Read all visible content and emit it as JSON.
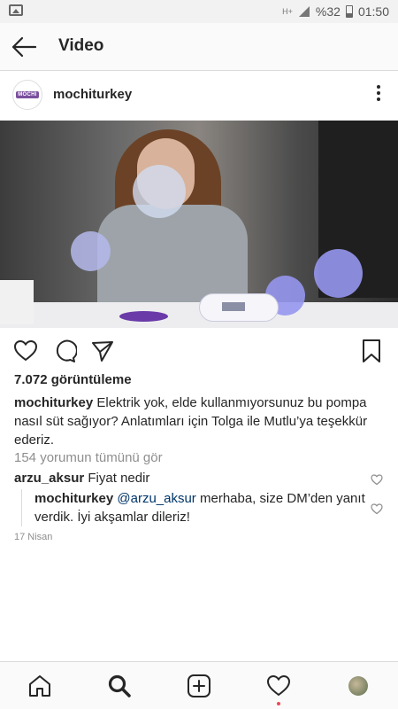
{
  "status_bar": {
    "battery": "%32",
    "time": "01:50",
    "network": "H+"
  },
  "header": {
    "title": "Video"
  },
  "post": {
    "username": "mochiturkey",
    "avatar_logo_text": "MOCHI",
    "views": "7.072 görüntüleme",
    "caption_user": "mochiturkey",
    "caption_text": "Elektrik yok, elde kullanmıyorsunuz bu pompa nasıl süt sağıyor? Anlatımları için Tolga ile Mutlu’ya teşekkür ederiz.",
    "view_all_comments": "154 yorumun tümünü gör",
    "comment": {
      "user": "arzu_aksur",
      "text": "Fiyat nedir"
    },
    "reply": {
      "user": "mochiturkey",
      "mention": "@arzu_aksur",
      "text": "merhaba, size DM’den yanıt verdik. İyi akşamlar dileriz!"
    },
    "date": "17 Nisan"
  },
  "icons": {
    "back": "arrow-left-icon",
    "more": "more-vertical-icon",
    "like": "heart-icon",
    "comment": "comment-icon",
    "share": "send-icon",
    "save": "bookmark-icon",
    "home": "home-icon",
    "search": "search-icon",
    "add": "add-post-icon",
    "activity": "heart-icon",
    "profile": "profile-avatar"
  },
  "colors": {
    "text": "#262626",
    "muted": "#8e8e8e",
    "mention": "#003569",
    "notification": "#ed4956"
  }
}
